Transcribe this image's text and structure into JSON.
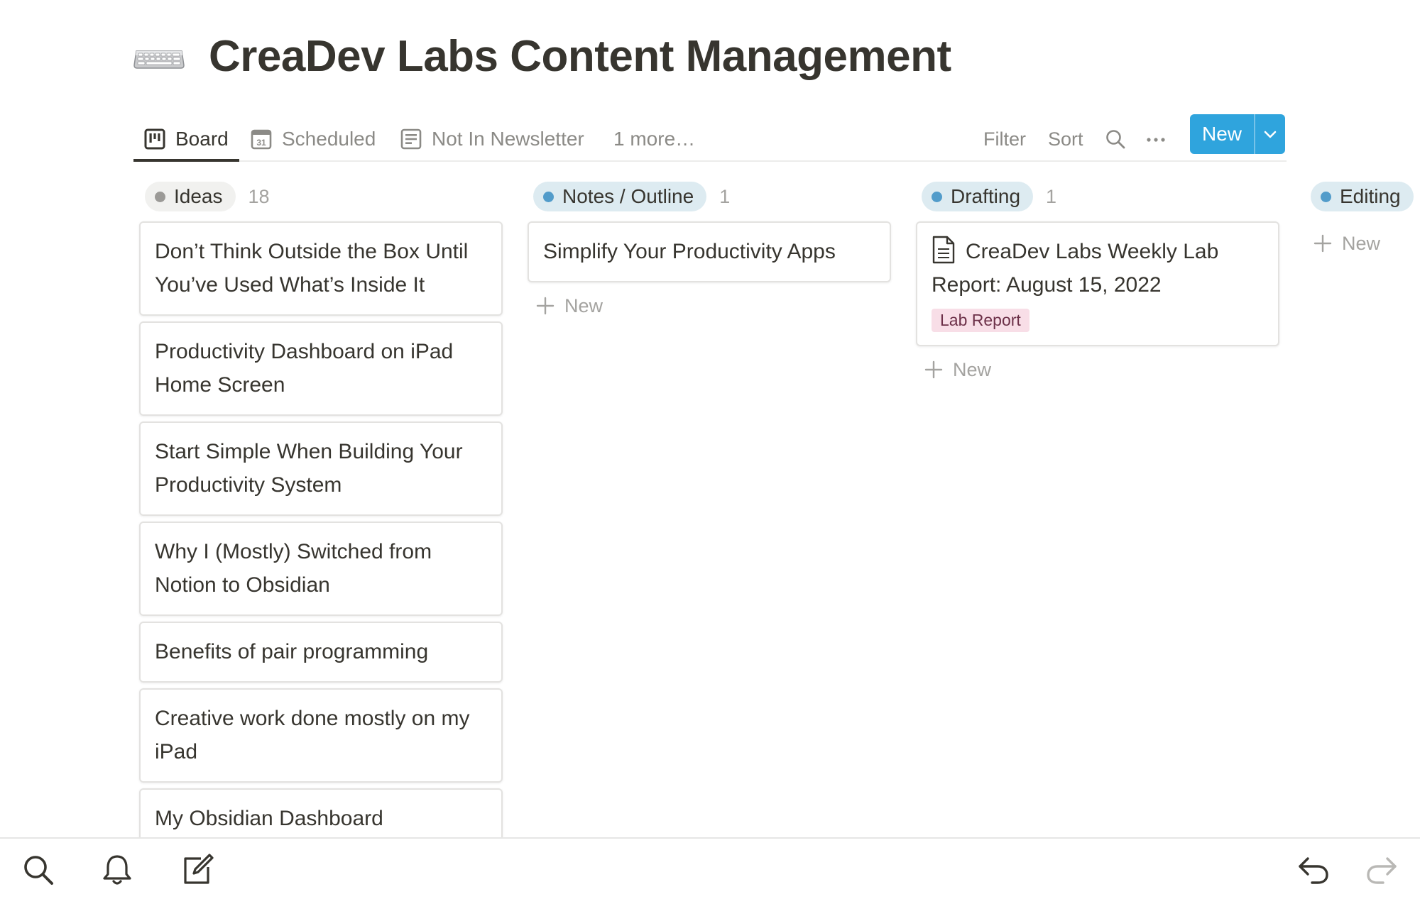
{
  "page": {
    "title": "CreaDev Labs Content Management",
    "icon": "keyboard-icon"
  },
  "views": {
    "tabs": [
      {
        "label": "Board",
        "icon": "board-icon",
        "active": true
      },
      {
        "label": "Scheduled",
        "icon": "calendar-icon",
        "active": false
      },
      {
        "label": "Not In Newsletter",
        "icon": "list-icon",
        "active": false
      }
    ],
    "more_label": "1 more…",
    "filter_label": "Filter",
    "sort_label": "Sort",
    "new_label": "New"
  },
  "board": {
    "add_label": "New",
    "columns": [
      {
        "name": "Ideas",
        "count": "18",
        "dot_color": "#9b9a97",
        "pill_color": "#f1f1ef",
        "cards": [
          {
            "title": "Don’t Think Outside the Box Until You’ve Used What’s Inside It"
          },
          {
            "title": "Productivity Dashboard on iPad Home Screen"
          },
          {
            "title": "Start Simple When Building Your Productivity System"
          },
          {
            "title": "Why I (Mostly) Switched from Notion to Obsidian"
          },
          {
            "title": "Benefits of pair programming"
          },
          {
            "title": "Creative work done mostly on my iPad"
          },
          {
            "title": "My Obsidian Dashboard"
          }
        ]
      },
      {
        "name": "Notes / Outline",
        "count": "1",
        "dot_color": "#529cca",
        "pill_color": "#ddebf1",
        "cards": [
          {
            "title": "Simplify Your Productivity Apps"
          }
        ]
      },
      {
        "name": "Drafting",
        "count": "1",
        "dot_color": "#529cca",
        "pill_color": "#ddebf1",
        "cards": [
          {
            "title": "CreaDev Labs Weekly Lab Report: August 15, 2022",
            "icon": "document-icon",
            "tag": "Lab Report",
            "tag_color": "#f8dee7"
          }
        ]
      },
      {
        "name": "Editing",
        "count": "",
        "dot_color": "#529cca",
        "pill_color": "#ddebf1",
        "cards": []
      }
    ]
  },
  "bottom_bar": {
    "left_icons": [
      "search-icon",
      "bell-icon",
      "compose-icon"
    ],
    "right_icons": [
      "undo-icon",
      "redo-icon"
    ]
  }
}
